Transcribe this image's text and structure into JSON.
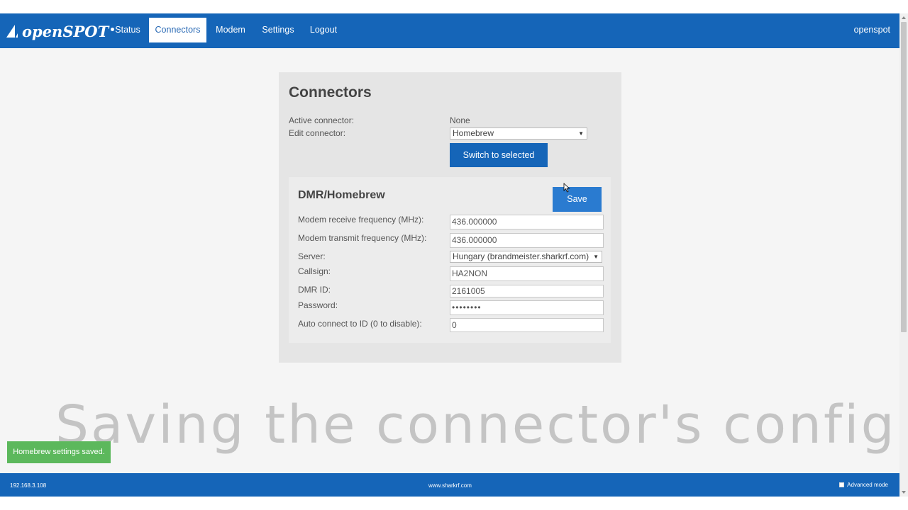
{
  "brand": {
    "name": "openSPOT"
  },
  "nav": {
    "items": [
      {
        "label": "Status"
      },
      {
        "label": "Connectors"
      },
      {
        "label": "Modem"
      },
      {
        "label": "Settings"
      },
      {
        "label": "Logout"
      }
    ],
    "active": "Connectors",
    "hostname": "openspot"
  },
  "connectors": {
    "title": "Connectors",
    "active_connector_label": "Active connector:",
    "active_connector_value": "None",
    "edit_connector_label": "Edit connector:",
    "edit_connector_value": "Homebrew",
    "switch_button": "Switch to selected"
  },
  "homebrew": {
    "title": "DMR/Homebrew",
    "save_button": "Save",
    "fields": [
      {
        "label": "Modem receive frequency (MHz):",
        "value": "436.000000"
      },
      {
        "label": "Modem transmit frequency (MHz):",
        "value": "436.000000"
      },
      {
        "label": "Server:",
        "value": "Hungary (brandmeister.sharkrf.com)"
      },
      {
        "label": "Callsign:",
        "value": "HA2NON"
      },
      {
        "label": "DMR ID:",
        "value": "2161005"
      },
      {
        "label": "Password:",
        "value": "••••••••"
      },
      {
        "label": "Auto connect to ID (0 to disable):",
        "value": "0"
      }
    ]
  },
  "overlay_caption": "Saving the connector's config",
  "toast": "Homebrew settings saved.",
  "footer": {
    "ip": "192.168.3.108",
    "url": "www.sharkrf.com",
    "advanced_mode": "Advanced mode"
  },
  "colors": {
    "primary": "#1565b8",
    "save_button": "#2a7bd0",
    "toast": "#5cb85c",
    "panel": "#e5e5e5",
    "background": "#f5f5f5"
  }
}
